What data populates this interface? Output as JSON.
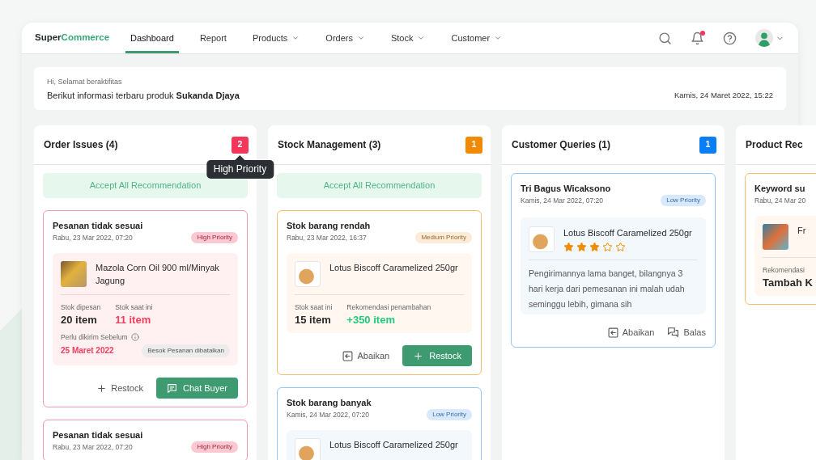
{
  "nav": {
    "logo": {
      "text": "Super",
      "highlight": "Commerce"
    },
    "items": [
      {
        "label": "Dashboard",
        "selected": true,
        "has_menu": false
      },
      {
        "label": "Report",
        "selected": false,
        "has_menu": false
      },
      {
        "label": "Products",
        "selected": false,
        "has_menu": true
      },
      {
        "label": "Orders",
        "selected": false,
        "has_menu": true
      },
      {
        "label": "Stock",
        "selected": false,
        "has_menu": true
      },
      {
        "label": "Customer",
        "selected": false,
        "has_menu": true
      }
    ],
    "has_notification": true
  },
  "greeting": {
    "salutation": "Hi, Selamat beraktifitas",
    "message": "Berikut informasi terbaru produk **Sukanda Djaya**",
    "timestamp": "Kamis, 24 Maret 2022, 15:22"
  },
  "columns": [
    {
      "title": "Order Issues (4)",
      "badge": "2",
      "color": "#f4365a",
      "tooltip": "High Priority",
      "accept_button": "Accept All Recommendation",
      "cards": [
        {
          "kind": "order",
          "title": "Pesanan tidak sesuai",
          "date": "Rabu, 23 Mar 2022, 07:20",
          "priority": {
            "kind": "high",
            "label": "High Priority"
          },
          "product": {
            "name": "Mazola Corn Oil 900 ml/Minyak Jagung"
          },
          "stats": [
            {
              "kind": "plain",
              "label": "Stok dipesan",
              "value": "20 item"
            },
            {
              "kind": "alert",
              "label": "Stok saat ini",
              "value": "11 item"
            }
          ],
          "deadline": {
            "label": "Perlu dikirim Sebelum",
            "date": "25 Maret 2022",
            "note": "Besok Pesanan dibatalkan"
          },
          "actions": [
            {
              "kind": "restock",
              "label": "Restock",
              "primary": false
            },
            {
              "kind": "chat",
              "label": "Chat Buyer",
              "primary": true
            }
          ]
        },
        {
          "kind": "order",
          "title": "Pesanan tidak sesuai",
          "date": "Rabu, 23 Mar 2022, 07:20",
          "priority": {
            "kind": "high",
            "label": "High Priority"
          }
        }
      ]
    },
    {
      "title": "Stock Management (3)",
      "badge": "1",
      "color": "#f18a00",
      "accept_button": "Accept All Recommendation",
      "cards": [
        {
          "kind": "stock",
          "title": "Stok barang rendah",
          "date": "Rabu, 23 Mar 2022, 16:37",
          "priority": {
            "kind": "medium",
            "label": "Medium Priority"
          },
          "product": {
            "name": "Lotus Biscoff Caramelized 250gr"
          },
          "stats": [
            {
              "kind": "plain",
              "label": "Stok saat ini",
              "value": "15 item"
            },
            {
              "kind": "positive",
              "label": "Rekomendasi penambahan",
              "value": "+350 item"
            }
          ],
          "actions": [
            {
              "kind": "dismiss",
              "label": "Abaikan",
              "primary": false
            },
            {
              "kind": "restock",
              "label": "Restock",
              "primary": true
            }
          ]
        },
        {
          "kind": "stock",
          "title": "Stok barang banyak",
          "date": "Kamis, 24 Mar 2022, 07:20",
          "priority": {
            "kind": "low",
            "label": "Low Priority"
          },
          "product": {
            "name": "Lotus Biscoff Caramelized 250gr"
          }
        }
      ]
    },
    {
      "title": "Customer Queries (1)",
      "badge": "1",
      "color": "#0a7ff5",
      "cards": [
        {
          "kind": "query",
          "title": "Tri Bagus Wicaksono",
          "date": "Kamis, 24 Mar 2022, 07:20",
          "priority": {
            "kind": "low",
            "label": "Low Priority"
          },
          "product": {
            "name": "Lotus Biscoff Caramelized 250gr",
            "stars": 3
          },
          "comment": "Pengirimannya lama banget, bilangnya 3 hari kerja dari pemesanan ini malah udah seminggu lebih, gimana sih",
          "actions": [
            {
              "kind": "dismiss",
              "label": "Abaikan",
              "primary": false
            },
            {
              "kind": "reply",
              "label": "Balas",
              "primary": false
            }
          ]
        }
      ]
    },
    {
      "title": "Product Rec",
      "cards": [
        {
          "kind": "recommendation",
          "title": "Keyword su",
          "date": "Rabu, 24 Mar 20",
          "priority": {
            "kind": "medium"
          },
          "product": {
            "name": "Fr"
          },
          "stats": [
            {
              "kind": "plain",
              "label": "Rekomendasi",
              "value": "Tambah K"
            }
          ]
        }
      ]
    }
  ]
}
